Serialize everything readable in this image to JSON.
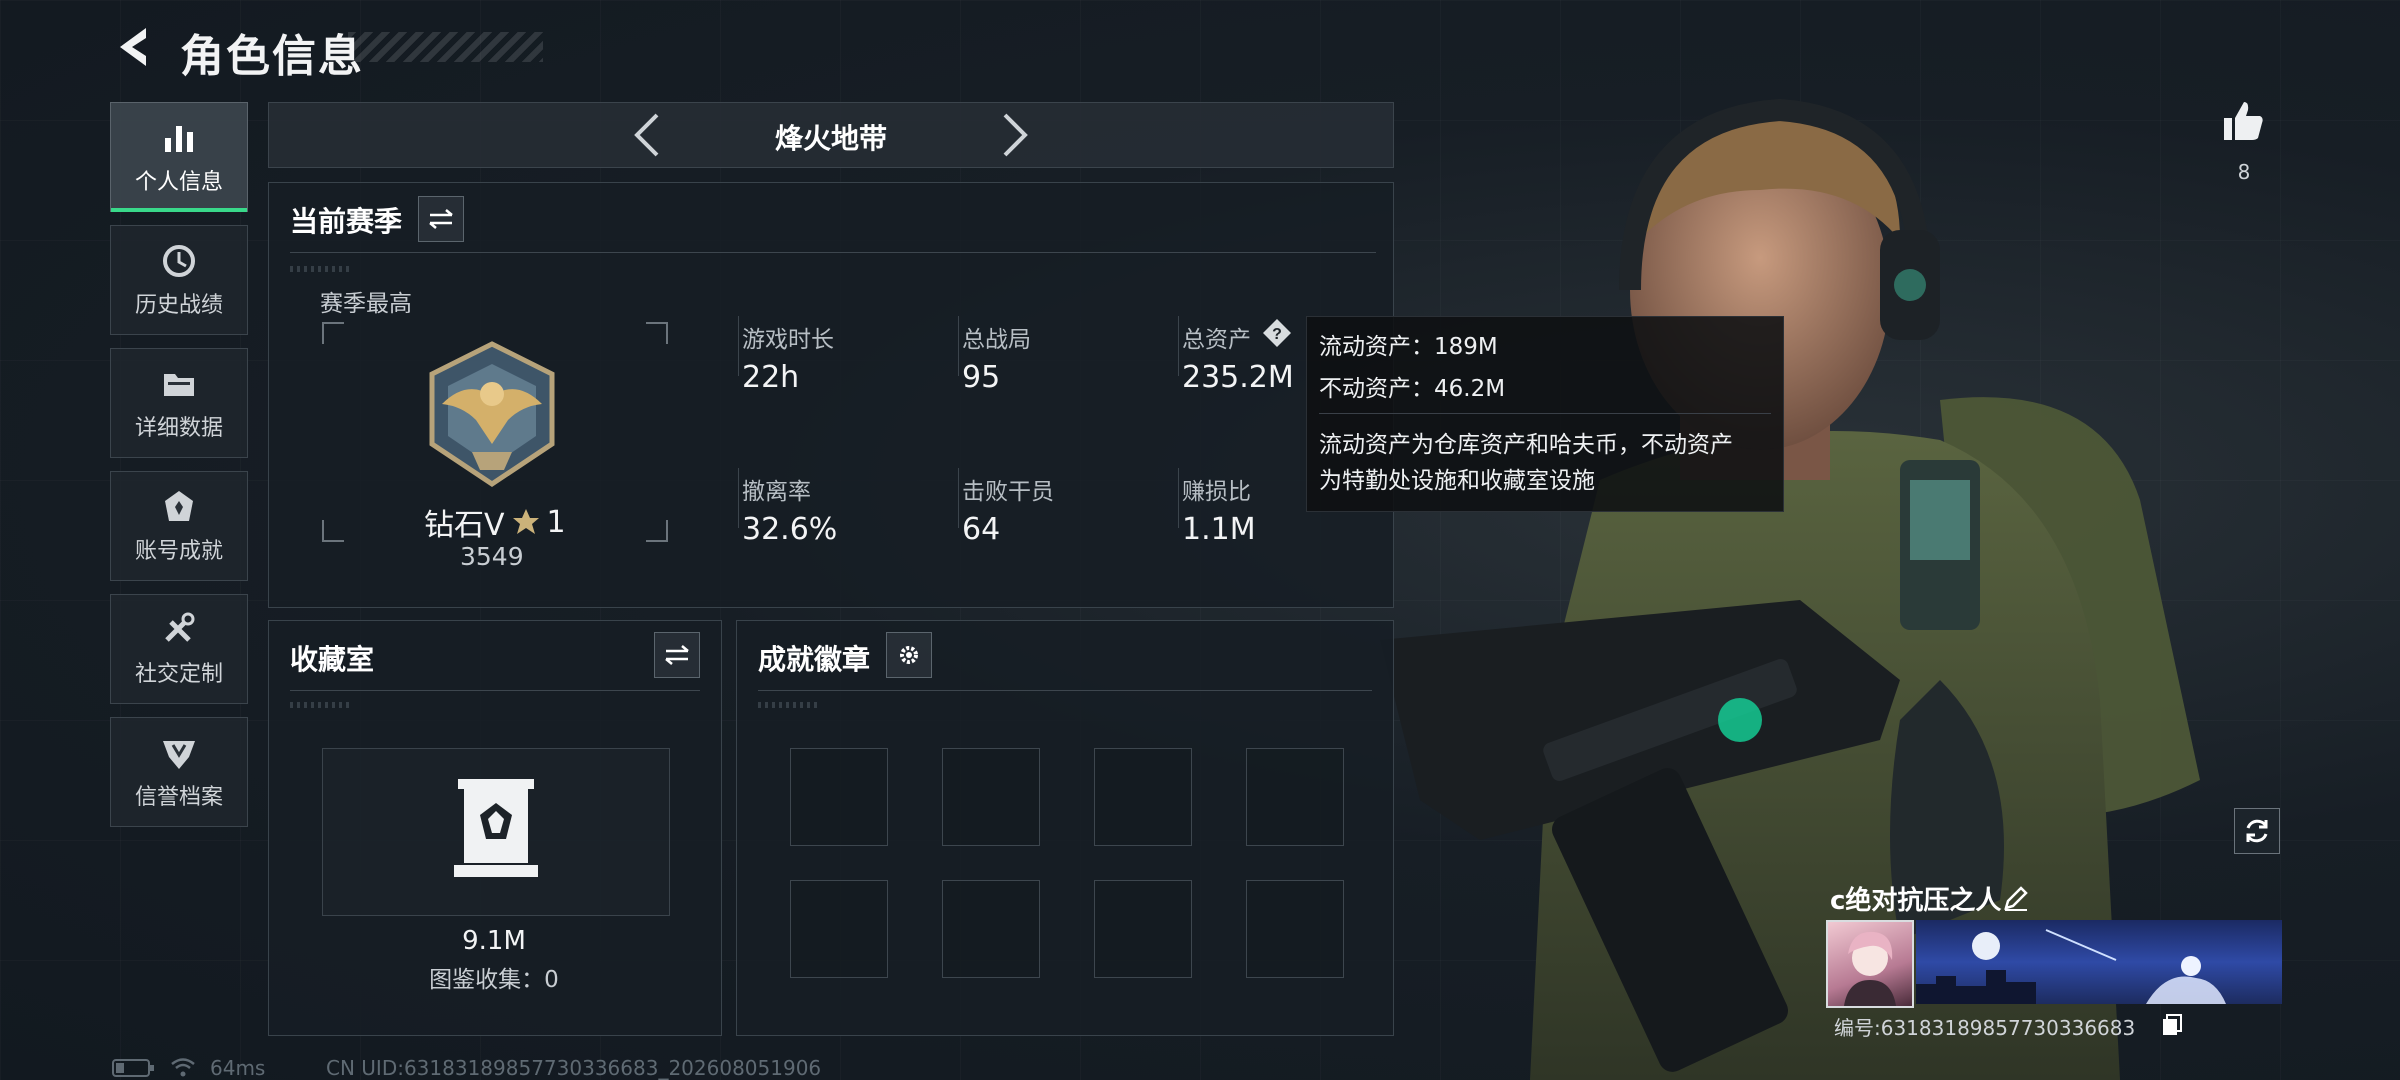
{
  "header": {
    "title": "角色信息"
  },
  "sidebar": {
    "items": [
      {
        "label": "个人信息",
        "icon": "bar-chart-icon",
        "active": true
      },
      {
        "label": "历史战绩",
        "icon": "history-clock-icon",
        "active": false
      },
      {
        "label": "详细数据",
        "icon": "folder-icon",
        "active": false
      },
      {
        "label": "账号成就",
        "icon": "achievement-icon",
        "active": false
      },
      {
        "label": "社交定制",
        "icon": "tools-icon",
        "active": false
      },
      {
        "label": "信誉档案",
        "icon": "reputation-icon",
        "active": false
      }
    ]
  },
  "mode": {
    "title": "烽火地带"
  },
  "season": {
    "title": "当前赛季",
    "best_label": "赛季最高",
    "rank_name": "钻石V",
    "rank_stars": "1",
    "rank_score": "3549",
    "stats": [
      {
        "label": "游戏时长",
        "value": "22h"
      },
      {
        "label": "总战局",
        "value": "95"
      },
      {
        "label": "总资产",
        "value": "235.2M"
      },
      {
        "label": "撤离率",
        "value": "32.6%"
      },
      {
        "label": "击败干员",
        "value": "64"
      },
      {
        "label": "赚损比",
        "value": "1.1M"
      }
    ]
  },
  "tooltip": {
    "line1": "流动资产：189M",
    "line2": "不动资产：46.2M",
    "desc1": "流动资产为仓库资产和哈夫币，不动资产",
    "desc2": "为特勤处设施和收藏室设施"
  },
  "collection": {
    "title": "收藏室",
    "value": "9.1M",
    "catalog": "图鉴收集：0"
  },
  "badges": {
    "title": "成就徽章",
    "slots": 8
  },
  "social": {
    "likes": "8"
  },
  "player": {
    "name": "c绝对抗压之人",
    "id": "编号:6318318985773033668​3"
  },
  "status": {
    "ping": "64ms",
    "uid": "CN UID:6318318985773033668​3_202608051906"
  },
  "colors": {
    "accent": "#39d98a",
    "bg": "#171e25"
  }
}
